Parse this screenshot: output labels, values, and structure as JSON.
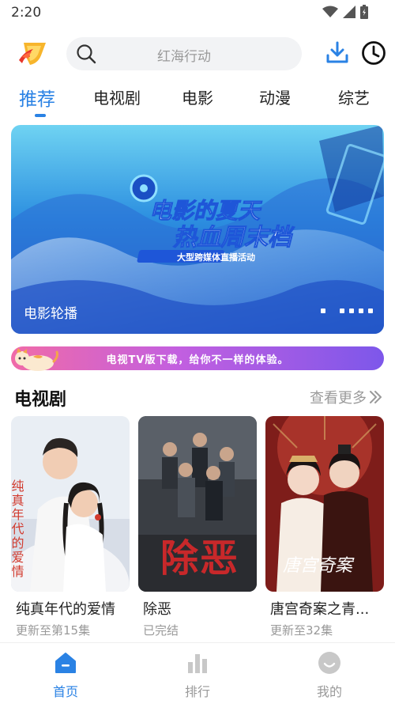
{
  "status": {
    "time": "2:20"
  },
  "search": {
    "placeholder": "红海行动"
  },
  "tabs": [
    {
      "label": "推荐"
    },
    {
      "label": "电视剧"
    },
    {
      "label": "电影"
    },
    {
      "label": "动漫"
    },
    {
      "label": "综艺"
    }
  ],
  "banner": {
    "label": "电影轮播",
    "headline": "电影的夏天 热血周末档",
    "subheadline": "大型跨媒体直播活动"
  },
  "promo": {
    "text": "电视TV版下载，给你不一样的体验。"
  },
  "section": {
    "title": "电视剧",
    "more_label": "查看更多"
  },
  "cards": [
    {
      "title": "纯真年代的爱情",
      "subtitle": "更新至第15集",
      "poster_text": "纯真年代的爱情"
    },
    {
      "title": "除恶",
      "subtitle": "已完结",
      "poster_text": "除恶"
    },
    {
      "title": "唐宫奇案之青...",
      "subtitle": "更新至32集",
      "poster_text": "唐宫奇案"
    }
  ],
  "nav": [
    {
      "label": "首页"
    },
    {
      "label": "排行"
    },
    {
      "label": "我的"
    }
  ],
  "colors": {
    "accent": "#2a82e4",
    "text": "#222222",
    "muted": "#999999"
  }
}
